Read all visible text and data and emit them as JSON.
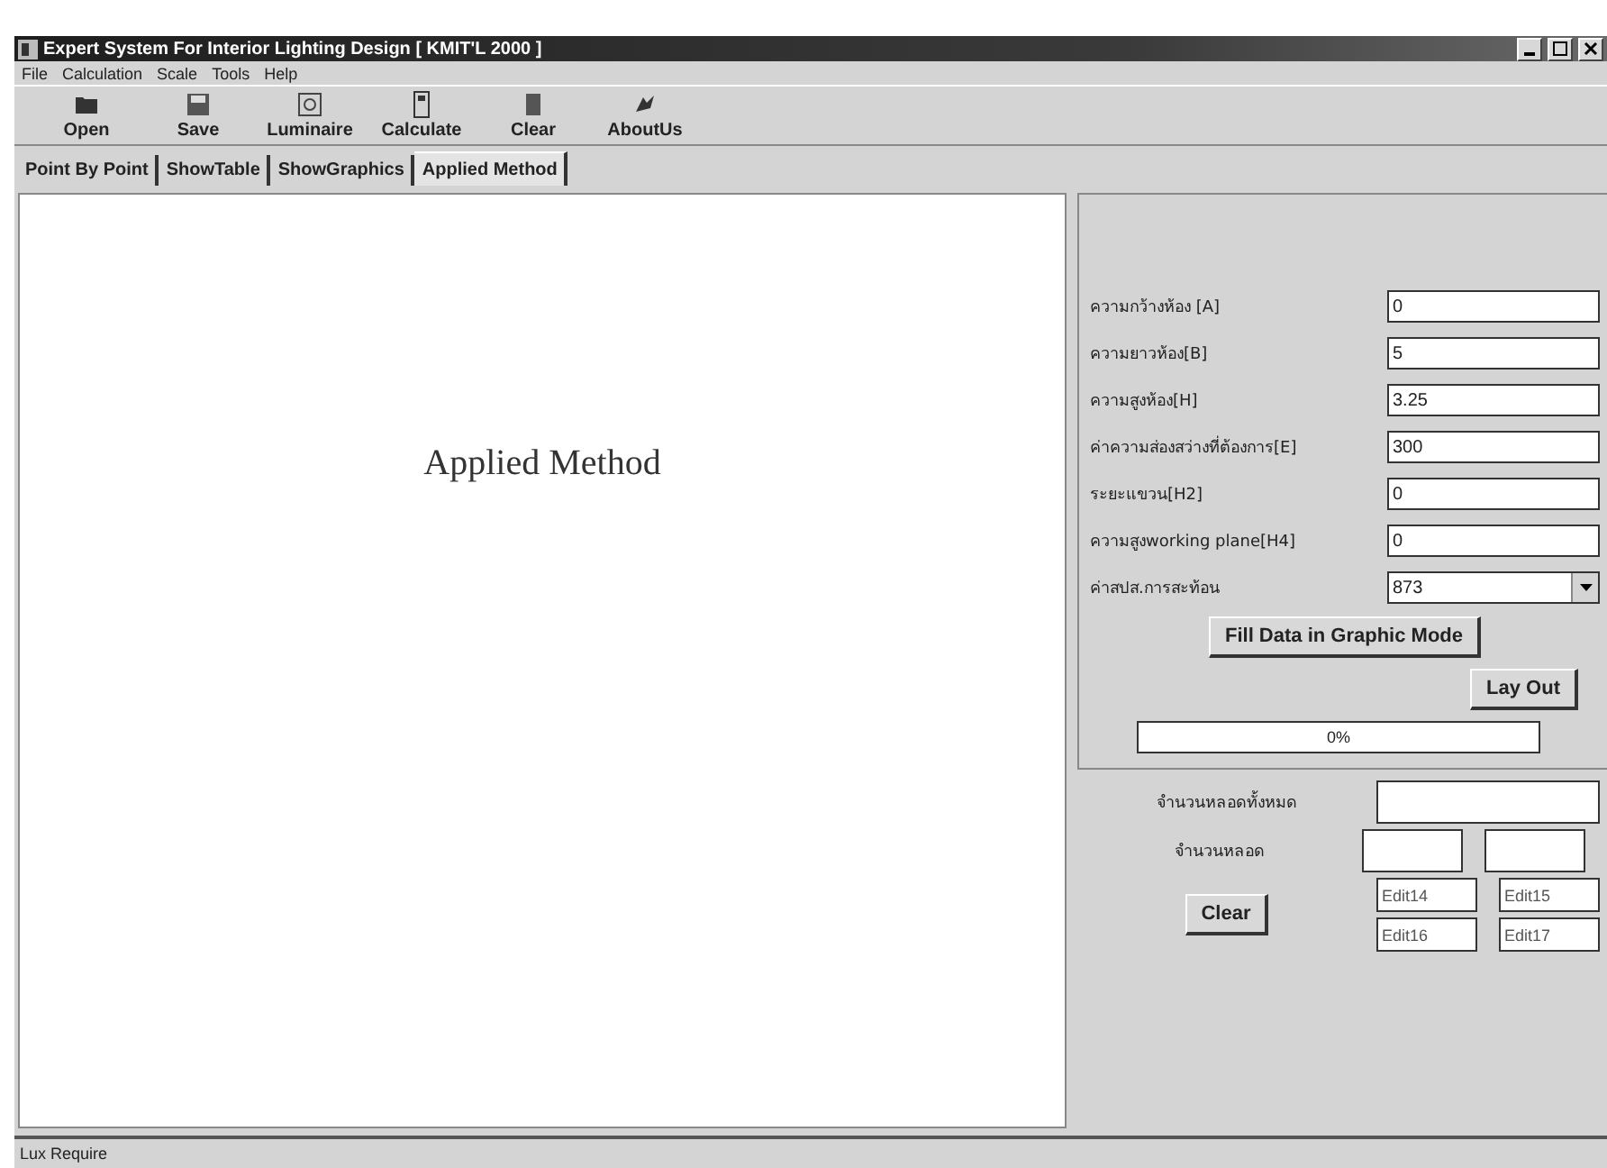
{
  "window": {
    "title": "Expert System For Interior Lighting Design [ KMIT'L 2000 ]"
  },
  "menu": [
    "File",
    "Calculation",
    "Scale",
    "Tools",
    "Help"
  ],
  "toolbar": [
    "Open",
    "Save",
    "Luminaire",
    "Calculate",
    "Clear",
    "AboutUs"
  ],
  "tabs": [
    {
      "label": "Point By Point",
      "selected": false
    },
    {
      "label": "ShowTable",
      "selected": false
    },
    {
      "label": "ShowGraphics",
      "selected": false
    },
    {
      "label": "Applied Method",
      "selected": true
    }
  ],
  "canvas": {
    "heading": "Applied Method"
  },
  "fields": [
    {
      "kind": "text",
      "label": "ความกว้างห้อง [A]",
      "value": "0"
    },
    {
      "kind": "text",
      "label": "ความยาวห้อง[B]",
      "value": "5"
    },
    {
      "kind": "text",
      "label": "ความสูงห้อง[H]",
      "value": "3.25"
    },
    {
      "kind": "text",
      "label": "ค่าความส่องสว่างที่ต้องการ[E]",
      "value": "300"
    },
    {
      "kind": "text",
      "label": "ระยะแขวน[H2]",
      "value": "0"
    },
    {
      "kind": "text",
      "label": "ความสูงworking plane[H4]",
      "value": "0"
    },
    {
      "kind": "select",
      "label": "ค่าสปส.การสะท้อน",
      "value": "873"
    }
  ],
  "fill_button": "Fill Data in Graphic Mode",
  "layout_button": "Lay Out",
  "progress": {
    "level": 0,
    "text": "0%"
  },
  "lamps": {
    "total_label": "จำนวนหลอดทั้งหมด",
    "count_label": "จำนวนหลอด",
    "clear_button": "Clear",
    "edits": [
      "Edit14",
      "Edit15",
      "Edit16",
      "Edit17"
    ]
  },
  "status_bar": "Lux Require"
}
